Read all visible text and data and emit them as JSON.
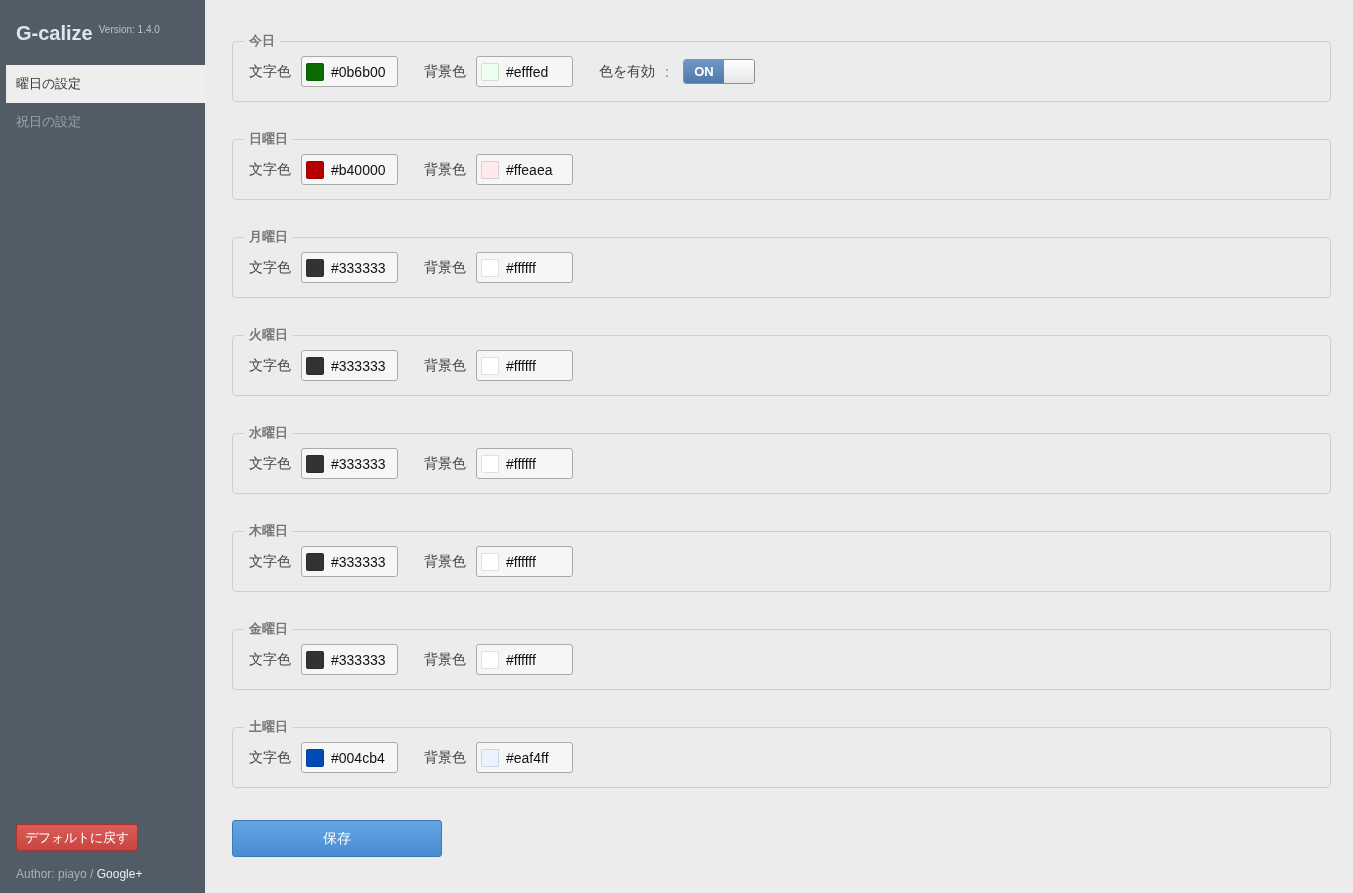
{
  "sidebar": {
    "app_name": "G-calize",
    "version": "Version: 1.4.0",
    "items": [
      {
        "label": "曜日の設定",
        "selected": true
      },
      {
        "label": "祝日の設定",
        "selected": false
      }
    ],
    "reset_button": "デフォルトに戻す",
    "author": "Author: piayo /",
    "author_link": "Google+"
  },
  "sections": [
    {
      "legend": "今日",
      "fields": [
        {
          "label": "文字色",
          "value": "#0b6b00",
          "color": "#0b6b00"
        },
        {
          "label": "背景色",
          "value": "#efffed",
          "color": "#efffed"
        }
      ],
      "toggle": {
        "label": "色を有効",
        "separator": ":",
        "on": true,
        "on_label": "ON"
      }
    },
    {
      "legend": "日曜日",
      "fields": [
        {
          "label": "文字色",
          "value": "#b40000",
          "color": "#b40000"
        },
        {
          "label": "背景色",
          "value": "#ffeaea",
          "color": "#ffeaea"
        }
      ]
    },
    {
      "legend": "月曜日",
      "fields": [
        {
          "label": "文字色",
          "value": "#333333",
          "color": "#333333"
        },
        {
          "label": "背景色",
          "value": "#ffffff",
          "color": "#ffffff"
        }
      ]
    },
    {
      "legend": "火曜日",
      "fields": [
        {
          "label": "文字色",
          "value": "#333333",
          "color": "#333333"
        },
        {
          "label": "背景色",
          "value": "#ffffff",
          "color": "#ffffff"
        }
      ]
    },
    {
      "legend": "水曜日",
      "fields": [
        {
          "label": "文字色",
          "value": "#333333",
          "color": "#333333"
        },
        {
          "label": "背景色",
          "value": "#ffffff",
          "color": "#ffffff"
        }
      ]
    },
    {
      "legend": "木曜日",
      "fields": [
        {
          "label": "文字色",
          "value": "#333333",
          "color": "#333333"
        },
        {
          "label": "背景色",
          "value": "#ffffff",
          "color": "#ffffff"
        }
      ]
    },
    {
      "legend": "金曜日",
      "fields": [
        {
          "label": "文字色",
          "value": "#333333",
          "color": "#333333"
        },
        {
          "label": "背景色",
          "value": "#ffffff",
          "color": "#ffffff"
        }
      ]
    },
    {
      "legend": "土曜日",
      "fields": [
        {
          "label": "文字色",
          "value": "#004cb4",
          "color": "#004cb4"
        },
        {
          "label": "背景色",
          "value": "#eaf4ff",
          "color": "#eaf4ff"
        }
      ]
    }
  ],
  "save_button": "保存"
}
